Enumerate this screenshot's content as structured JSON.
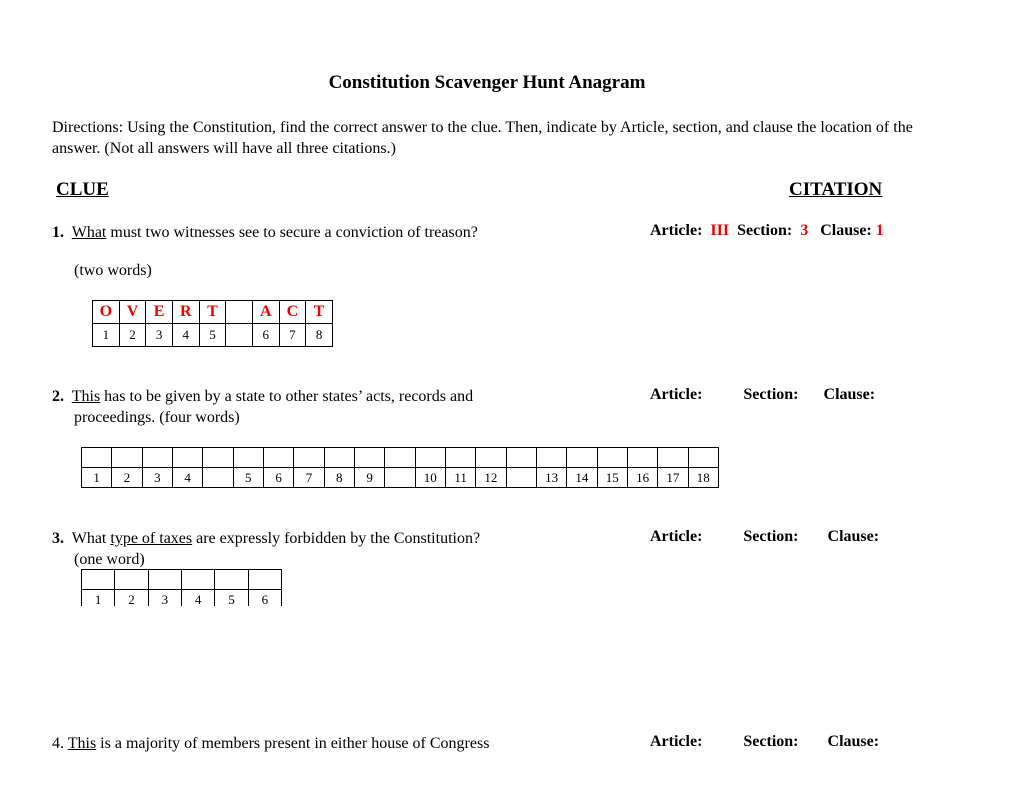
{
  "title": "Constitution Scavenger Hunt Anagram",
  "directions": "Directions: Using the Constitution, find the correct answer to the clue. Then, indicate by Article, section, and clause the location of the answer. (Not all answers will have all three citations.)",
  "headers": {
    "clue": "CLUE",
    "citation": "CITATION"
  },
  "citation_labels": {
    "article": "Article:",
    "section": "Section:",
    "clause": "Clause:"
  },
  "colors": {
    "answer": "#ee0000"
  },
  "questions": [
    {
      "number": "1.",
      "underlined": "What",
      "text": " must two witnesses see to secure a conviction of treason?",
      "hint": "(two words)",
      "citation": {
        "article": "III",
        "section": "3",
        "clause": "1"
      },
      "letters": [
        "O",
        "V",
        "E",
        "R",
        "T",
        "",
        "A",
        "C",
        "T"
      ],
      "indices": [
        "1",
        "2",
        "3",
        "4",
        "5",
        "",
        "6",
        "7",
        "8"
      ]
    },
    {
      "number": "2.",
      "underlined": "This",
      "text": " has to be given by a state to other states’ acts, records and",
      "text2": "proceedings. (four words)",
      "citation": {
        "article": "",
        "section": "",
        "clause": ""
      },
      "indices": [
        "1",
        "2",
        "3",
        "4",
        "",
        "5",
        "6",
        "7",
        "8",
        "9",
        "",
        "10",
        "11",
        "12",
        "",
        "13",
        "14",
        "15",
        "16",
        "17",
        "18"
      ]
    },
    {
      "number": "3.",
      "prefix": "What ",
      "underlined": "type of taxes",
      "text": " are expressly forbidden by the Constitution?",
      "hint": "(one word)",
      "citation": {
        "article": "",
        "section": "",
        "clause": ""
      },
      "indices": [
        "1",
        "2",
        "3",
        "4",
        "5",
        "6"
      ]
    },
    {
      "number": "4.",
      "underlined": "This",
      "text": " is a majority of members present in either house of Congress",
      "citation": {
        "article": "",
        "section": "",
        "clause": ""
      }
    }
  ]
}
